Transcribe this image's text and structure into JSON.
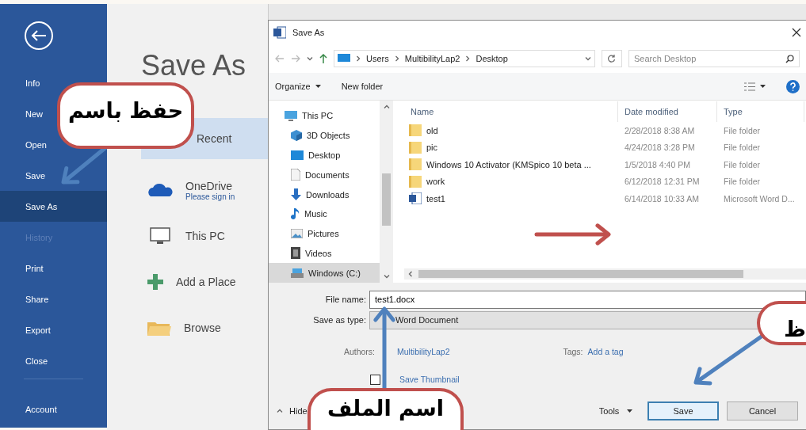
{
  "backstage": {
    "nav": [
      {
        "label": "Info",
        "selected": false,
        "disabled": false
      },
      {
        "label": "New",
        "selected": false,
        "disabled": false
      },
      {
        "label": "Open",
        "selected": false,
        "disabled": false
      },
      {
        "label": "Save",
        "selected": false,
        "disabled": false
      },
      {
        "label": "Save As",
        "selected": true,
        "disabled": false
      },
      {
        "label": "History",
        "selected": false,
        "disabled": true
      },
      {
        "label": "Print",
        "selected": false,
        "disabled": false
      },
      {
        "label": "Share",
        "selected": false,
        "disabled": false
      },
      {
        "label": "Export",
        "selected": false,
        "disabled": false
      },
      {
        "label": "Close",
        "selected": false,
        "disabled": false
      }
    ],
    "account": "Account",
    "title": "Save As",
    "places": [
      {
        "kind": "recent",
        "label": "Recent",
        "selected": true
      },
      {
        "kind": "onedrive",
        "label": "OneDrive",
        "sublabel": "Please sign in",
        "selected": false
      },
      {
        "kind": "pc",
        "label": "This PC",
        "selected": false
      },
      {
        "kind": "add",
        "label": "Add a Place",
        "selected": false
      },
      {
        "kind": "browse",
        "label": "Browse",
        "selected": false
      }
    ]
  },
  "dialog": {
    "title": "Save As",
    "path": [
      "Users",
      "MultibilityLap2",
      "Desktop"
    ],
    "search": {
      "placeholder": "Search Desktop"
    },
    "toolbar": {
      "organize": "Organize",
      "new_folder": "New folder"
    },
    "nav_pane": [
      {
        "kind": "pc",
        "label": "This PC",
        "selected": false
      },
      {
        "kind": "objects",
        "label": "3D Objects",
        "selected": false
      },
      {
        "kind": "desktop",
        "label": "Desktop",
        "selected": false
      },
      {
        "kind": "documents",
        "label": "Documents",
        "selected": false
      },
      {
        "kind": "downloads",
        "label": "Downloads",
        "selected": false
      },
      {
        "kind": "music",
        "label": "Music",
        "selected": false
      },
      {
        "kind": "pictures",
        "label": "Pictures",
        "selected": false
      },
      {
        "kind": "videos",
        "label": "Videos",
        "selected": false
      },
      {
        "kind": "drive",
        "label": "Windows (C:)",
        "selected": true
      }
    ],
    "columns": [
      "Name",
      "Date modified",
      "Type"
    ],
    "rows": [
      {
        "kind": "folder",
        "name": "old",
        "date": "2/28/2018 8:38 AM",
        "type": "File folder"
      },
      {
        "kind": "folder",
        "name": "pic",
        "date": "4/24/2018 3:28 PM",
        "type": "File folder"
      },
      {
        "kind": "folder",
        "name": "Windows 10 Activator (KMSpico 10 beta ...",
        "date": "1/5/2018 4:40 PM",
        "type": "File folder"
      },
      {
        "kind": "folder",
        "name": "work",
        "date": "6/12/2018 12:31 PM",
        "type": "File folder"
      },
      {
        "kind": "word",
        "name": "test1",
        "date": "6/14/2018 10:33 AM",
        "type": "Microsoft Word D..."
      }
    ],
    "file_name": {
      "label": "File name:",
      "value": "test1.docx"
    },
    "save_type": {
      "label": "Save as type:",
      "value": "Word Document"
    },
    "authors": {
      "label": "Authors:",
      "value": "MultibilityLap2"
    },
    "tags": {
      "label": "Tags:",
      "value": "Add a tag"
    },
    "thumbnail": {
      "label": "Save Thumbnail",
      "checked": false
    },
    "hide": "Hide",
    "buttons": [
      {
        "kind": "menu",
        "label": "Tools"
      },
      {
        "kind": "primary",
        "label": "Save"
      },
      {
        "kind": "normal",
        "label": "Cancel"
      }
    ]
  },
  "callouts": [
    "حفظ باسم",
    "اسم الملف",
    "ظ"
  ]
}
